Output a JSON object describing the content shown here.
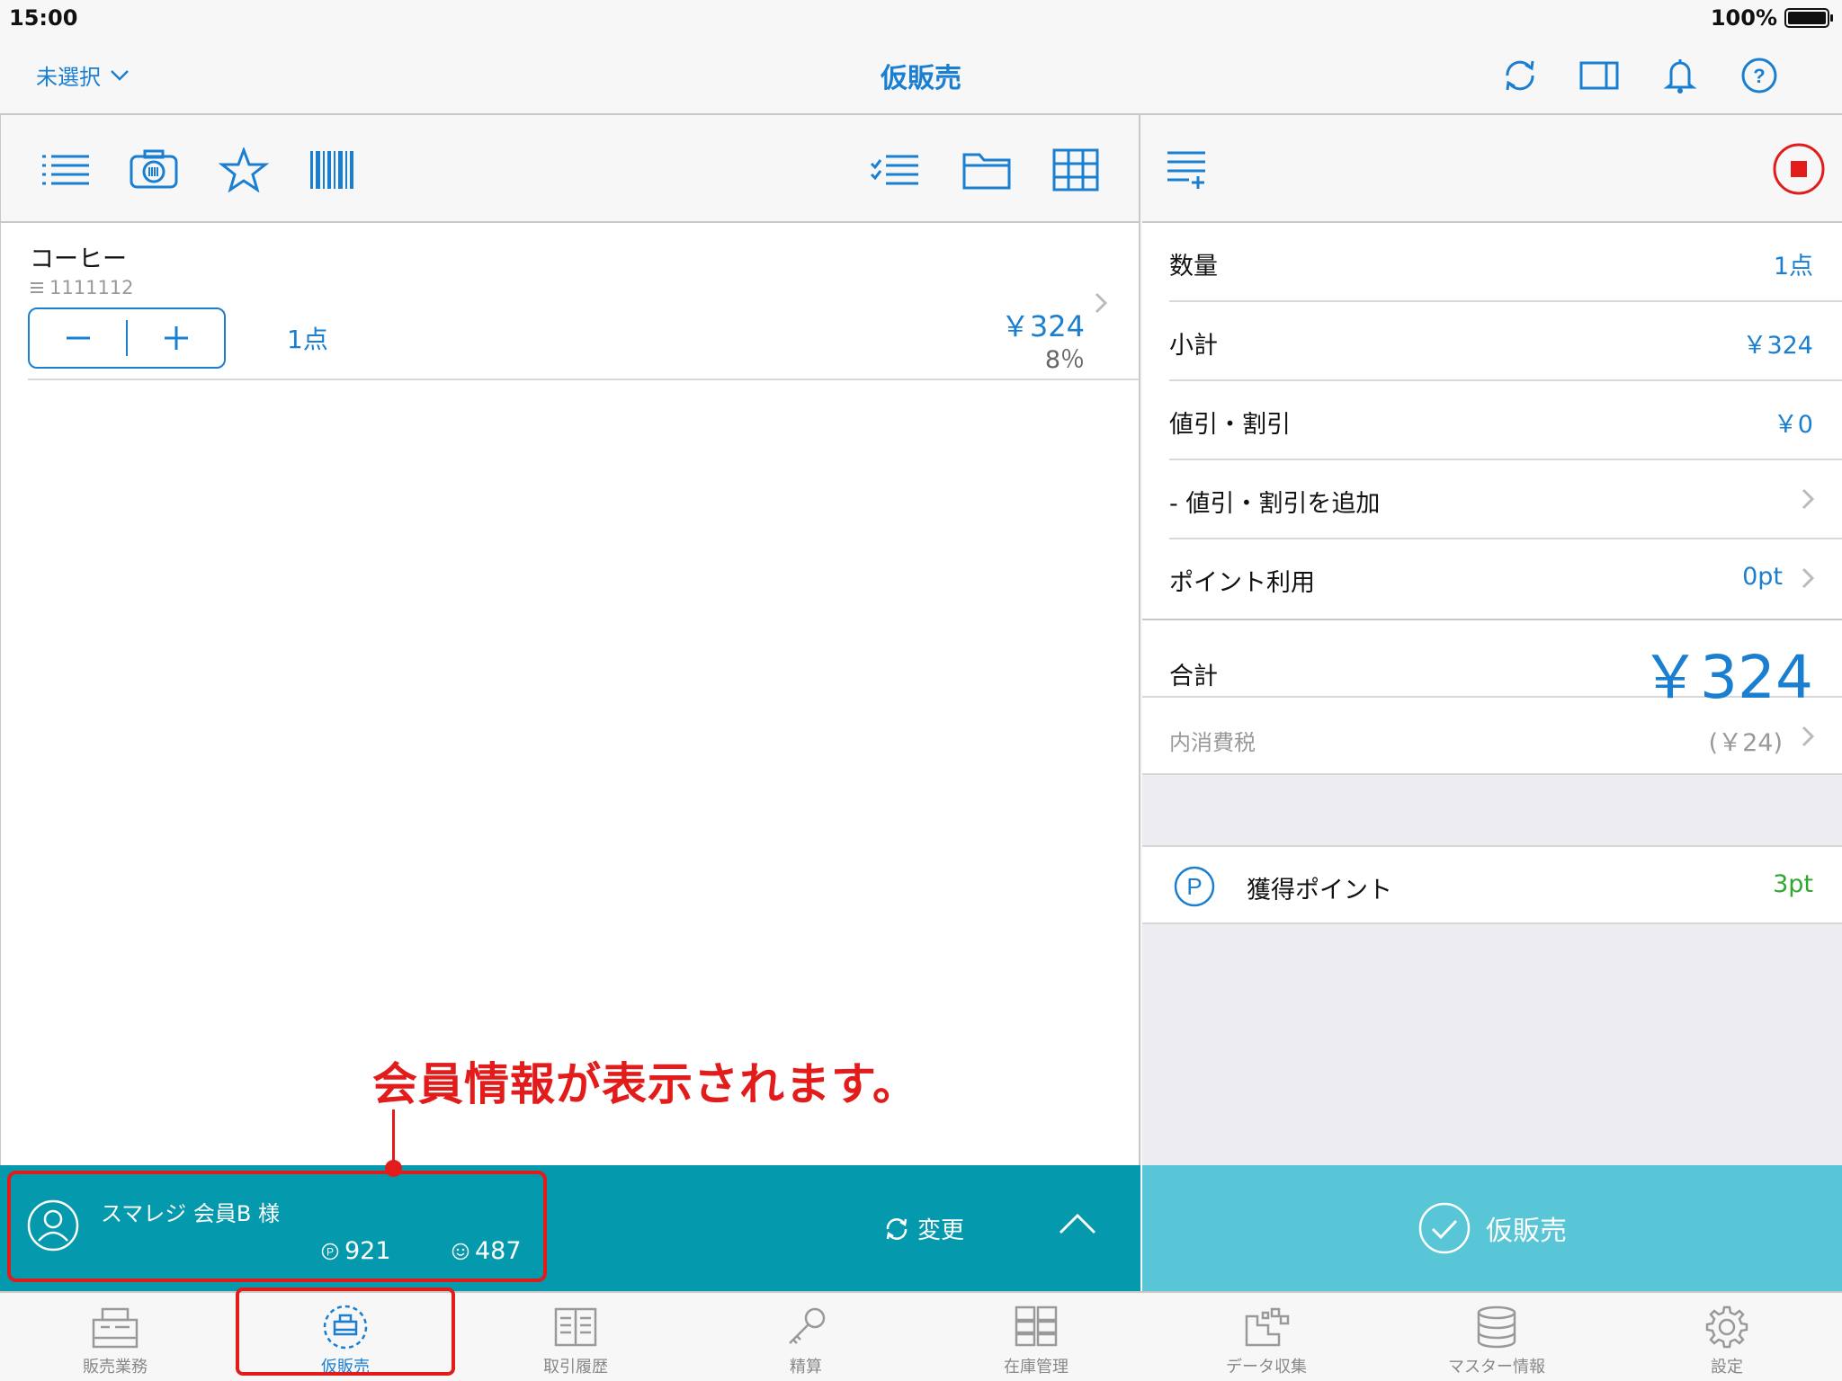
{
  "status": {
    "time": "15:00",
    "battery": "100%"
  },
  "nav": {
    "staff": "未選択",
    "title": "仮販売"
  },
  "product": {
    "name": "コーヒー",
    "code": "1111112",
    "qty": "1点",
    "price": "￥324",
    "tax_rate": "8％"
  },
  "summary": {
    "quantity_label": "数量",
    "quantity_value": "1点",
    "subtotal_label": "小計",
    "subtotal_value": "￥324",
    "discount_label": "値引・割引",
    "discount_value": "￥0",
    "add_discount_label": "- 値引・割引を追加",
    "point_use_label": "ポイント利用",
    "point_use_value": "0pt",
    "total_label": "合計",
    "total_value": "￥324",
    "tax_label": "内消費税",
    "tax_value": "(￥24)",
    "earned_points_label": "獲得ポイント",
    "earned_points_value": "3pt"
  },
  "member": {
    "name": "スマレジ 会員B 様",
    "points": "921",
    "stamps": "487",
    "change_label": "変更"
  },
  "checkout": {
    "label": "仮販売"
  },
  "annotation": {
    "text": "会員情報が表示されます。"
  },
  "tabs": [
    {
      "label": "販売業務",
      "icon": "register-icon"
    },
    {
      "label": "仮販売",
      "icon": "temp-sale-icon"
    },
    {
      "label": "取引履歴",
      "icon": "history-icon"
    },
    {
      "label": "精算",
      "icon": "key-icon"
    },
    {
      "label": "在庫管理",
      "icon": "inventory-icon"
    },
    {
      "label": "データ収集",
      "icon": "data-icon"
    },
    {
      "label": "マスター情報",
      "icon": "database-icon"
    },
    {
      "label": "設定",
      "icon": "gear-icon"
    }
  ],
  "colors": {
    "accent": "#1a7fd0",
    "member_bar": "#0599ad",
    "checkout": "#58c6d6",
    "annotation": "#e21b1b",
    "points": "#2fa82f"
  }
}
